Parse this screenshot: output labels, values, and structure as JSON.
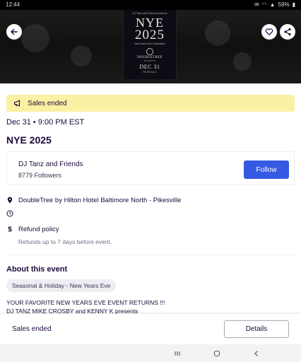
{
  "status_bar": {
    "time": "12:44",
    "battery": "59%"
  },
  "hero": {
    "poster": {
      "tag": "DJ Tanz and Friends presents",
      "nye": "NYE",
      "year": "2025",
      "subtitle": "New Year's Eve Celebration",
      "brand": "DOUBLETREE",
      "brand_sub": "BY HILTON",
      "date": "DEC 31",
      "footer": "PIKESVILLE"
    }
  },
  "banner": {
    "icon": "megaphone-icon",
    "text": "Sales ended"
  },
  "event": {
    "date_time": "Dec 31 • 9:00 PM EST",
    "title": "NYE 2025"
  },
  "organizer": {
    "name": "DJ Tanz and Friends",
    "followers": "8779 Followers",
    "follow_label": "Follow"
  },
  "details": {
    "location": "DoubleTree by Hilton Hotel Baltimore North - Pikesville",
    "refund_title": "Refund policy",
    "refund_sub": "Refunds up to 7 days before event."
  },
  "about": {
    "heading": "About this event",
    "chip": "Seasonal & Holiday - New Years Eve",
    "line1": "YOUR FAVORITE NEW YEARS EVE EVENT RETURNS !!!",
    "line2": "DJ TANZ MIKE CROSBY and KENNY K presents"
  },
  "bottom": {
    "status": "Sales ended",
    "details_label": "Details"
  },
  "colors": {
    "primary": "#3659e3",
    "banner_bg": "#fcf0a4",
    "text": "#1e0a3c"
  }
}
